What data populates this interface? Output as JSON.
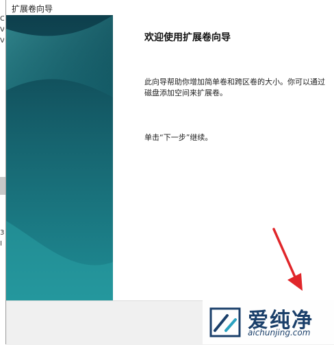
{
  "window": {
    "title": "扩展卷向导"
  },
  "wizard": {
    "heading": "欢迎使用扩展卷向导",
    "description_lines": [
      "此向导帮助你增加简单卷和跨区卷的大小。你可以通过",
      "磁盘添加空间来扩展卷。"
    ],
    "hint": "单击“下一步”继续。"
  },
  "background_fragments": [
    "C",
    "V",
    "V",
    "3",
    "I"
  ],
  "watermark": {
    "name": "爱纯净",
    "domain": "aichunjing.com"
  },
  "colors": {
    "panel_dark": "#0e3f4c",
    "panel_mid": "#1a7d86",
    "panel_light": "#2fa3a6",
    "arrow": "#e0262a"
  }
}
